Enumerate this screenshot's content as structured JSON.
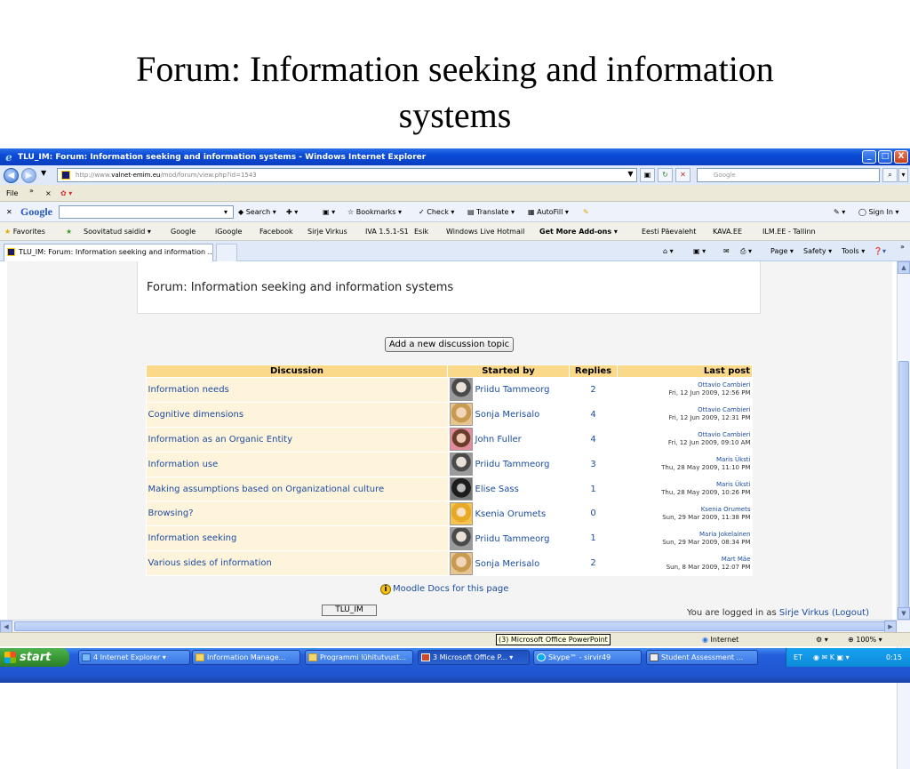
{
  "slide": {
    "title_line1": "Forum: Information seeking and information",
    "title_line2": "systems"
  },
  "window": {
    "title": "TLU_IM: Forum: Information seeking and information systems - Windows Internet Explorer",
    "minimize": "_",
    "maximize": "□",
    "close": "X"
  },
  "address": {
    "url_prefix": "http://www.",
    "url_host": "valnet-emim.eu",
    "url_path": "/mod/forum/view.php?id=1543",
    "search_placeholder": "Google"
  },
  "menu": {
    "file": "File",
    "chevron": "»",
    "close": "×"
  },
  "google_toolbar": {
    "logo": "Google",
    "search": "Search",
    "bookmarks": "Bookmarks",
    "check": "Check",
    "translate": "Translate",
    "autofill": "AutoFill",
    "signin": "Sign In"
  },
  "favorites": {
    "label": "Favorites",
    "items": [
      "Soovitatud saidid",
      "Google",
      "iGoogle",
      "Facebook",
      "Sirje Virkus",
      "IVA 1.5.1-S1",
      "Esik",
      "Windows Live Hotmail",
      "Get More Add-ons",
      "Eesti Päevaleht",
      "KAVA.EE",
      "ILM.EE - Tallinn"
    ]
  },
  "tab": {
    "label": "TLU_IM: Forum: Information seeking and information ...",
    "page": "Page",
    "safety": "Safety",
    "tools": "Tools",
    "chevron": "»"
  },
  "page": {
    "forum_heading": "Forum: Information seeking and information systems",
    "add_topic_button": "Add a new discussion topic",
    "table_headers": {
      "discussion": "Discussion",
      "started_by": "Started by",
      "replies": "Replies",
      "last_post": "Last post"
    },
    "rows": [
      {
        "discussion": "Information needs",
        "started_by": "Priidu Tammeorg",
        "avatar": "male-avatar",
        "replies": "2",
        "last_author": "Ottavio Cambieri",
        "last_date": "Fri, 12 Jun 2009, 12:56 PM"
      },
      {
        "discussion": "Cognitive dimensions",
        "started_by": "Sonja Merisalo",
        "avatar": "female-avatar",
        "replies": "4",
        "last_author": "Ottavio Cambieri",
        "last_date": "Fri, 12 Jun 2009, 12:31 PM"
      },
      {
        "discussion": "Information as an Organic Entity",
        "started_by": "John Fuller",
        "avatar": "male-avatar",
        "replies": "4",
        "last_author": "Ottavio Cambieri",
        "last_date": "Fri, 12 Jun 2009, 09:10 AM"
      },
      {
        "discussion": "Information use",
        "started_by": "Priidu Tammeorg",
        "avatar": "male-avatar",
        "replies": "3",
        "last_author": "Maris Üksti",
        "last_date": "Thu, 28 May 2009, 11:10 PM"
      },
      {
        "discussion": "Making assumptions based on Organizational culture",
        "started_by": "Elise Sass",
        "avatar": "female-avatar",
        "replies": "1",
        "last_author": "Maris Üksti",
        "last_date": "Thu, 28 May 2009, 10:26 PM"
      },
      {
        "discussion": "Browsing?",
        "started_by": "Ksenia Orumets",
        "avatar": "female-avatar",
        "replies": "0",
        "last_author": "Ksenia Orumets",
        "last_date": "Sun, 29 Mar 2009, 11:38 PM"
      },
      {
        "discussion": "Information seeking",
        "started_by": "Priidu Tammeorg",
        "avatar": "male-avatar",
        "replies": "1",
        "last_author": "Maria Jokelainen",
        "last_date": "Sun, 29 Mar 2009, 08:34 PM"
      },
      {
        "discussion": "Various sides of information",
        "started_by": "Sonja Merisalo",
        "avatar": "female-avatar",
        "replies": "2",
        "last_author": "Mart Mäe",
        "last_date": "Sun, 8 Mar 2009, 12:07 PM"
      }
    ],
    "moodle_docs": "Moodle Docs for this page",
    "course_button": "TLU_IM",
    "logged_in_prefix": "You are logged in as",
    "logged_in_user": "Sirje Virkus",
    "logout": "(Logout)"
  },
  "statusbar": {
    "tooltip": "(3) Microsoft Office PowerPoint",
    "zone": "Internet",
    "zoom": "100%"
  },
  "taskbar": {
    "start": "start",
    "items": [
      "4 Internet Explorer",
      "Information Manage...",
      "Programmi lühitutvust...",
      "3 Microsoft Office P...",
      "Skype™ - sirvir49",
      "Student Assessment ..."
    ],
    "lang": "ET",
    "clock": "0:15"
  },
  "colors": {
    "header_bg": "#fbd98a",
    "row_bg": "#fef4dc",
    "link": "#1b4ca0",
    "titlebar": "#0a4ad6"
  }
}
